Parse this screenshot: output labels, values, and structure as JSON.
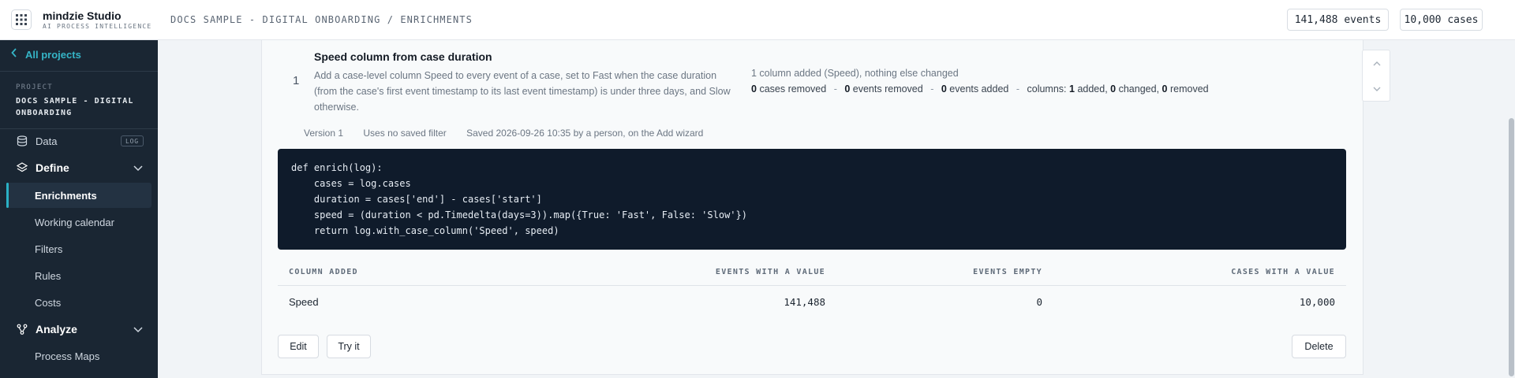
{
  "header": {
    "brand_name": "mindzie Studio",
    "brand_tagline": "AI PROCESS INTELLIGENCE",
    "breadcrumb": "DOCS SAMPLE - DIGITAL ONBOARDING / ENRICHMENTS",
    "events_count": "141,488 events",
    "cases_count": "10,000 cases"
  },
  "sidebar": {
    "back_label": "All projects",
    "project_label": "PROJECT",
    "project_name": "DOCS SAMPLE - DIGITAL ONBOARDING",
    "data_label": "Data",
    "data_badge": "LOG",
    "define_label": "Define",
    "define_items": [
      "Enrichments",
      "Working calendar",
      "Filters",
      "Rules",
      "Costs"
    ],
    "analyze_label": "Analyze",
    "analyze_items": [
      "Process Maps"
    ],
    "active_item": "Enrichments"
  },
  "enrichment": {
    "step_number": "1",
    "title": "Speed column from case duration",
    "description": "Add a case-level column Speed to every event of a case, set to Fast when the case duration (from the case's first event timestamp to its last event timestamp) is under three days, and Slow otherwise.",
    "summary": "1 column added (Speed), nothing else changed",
    "stats": {
      "cases_removed": "0",
      "cases_removed_label": "cases removed",
      "events_removed": "0",
      "events_removed_label": "events removed",
      "events_added": "0",
      "events_added_label": "events added",
      "columns_prefix": "columns:",
      "columns_added": "1",
      "columns_added_label": "added,",
      "columns_changed": "0",
      "columns_changed_label": "changed,",
      "columns_removed": "0",
      "columns_removed_label": "removed",
      "separator": "-"
    },
    "meta": {
      "version": "Version 1",
      "filter": "Uses no saved filter",
      "saved": "Saved 2026-09-26 10:35 by a person, on the Add wizard"
    },
    "code": "def enrich(log):\n    cases = log.cases\n    duration = cases['end'] - cases['start']\n    speed = (duration < pd.Timedelta(days=3)).map({True: 'Fast', False: 'Slow'})\n    return log.with_case_column('Speed', speed)",
    "table": {
      "headers": [
        "COLUMN ADDED",
        "EVENTS WITH A VALUE",
        "EVENTS EMPTY",
        "CASES WITH A VALUE"
      ],
      "rows": [
        [
          "Speed",
          "141,488",
          "0",
          "10,000"
        ]
      ]
    },
    "buttons": {
      "edit": "Edit",
      "try": "Try it",
      "delete": "Delete"
    }
  },
  "colors": {
    "sidebar_bg": "#1a2633",
    "accent": "#2ab0c5",
    "code_bg": "#0f1b2b"
  }
}
